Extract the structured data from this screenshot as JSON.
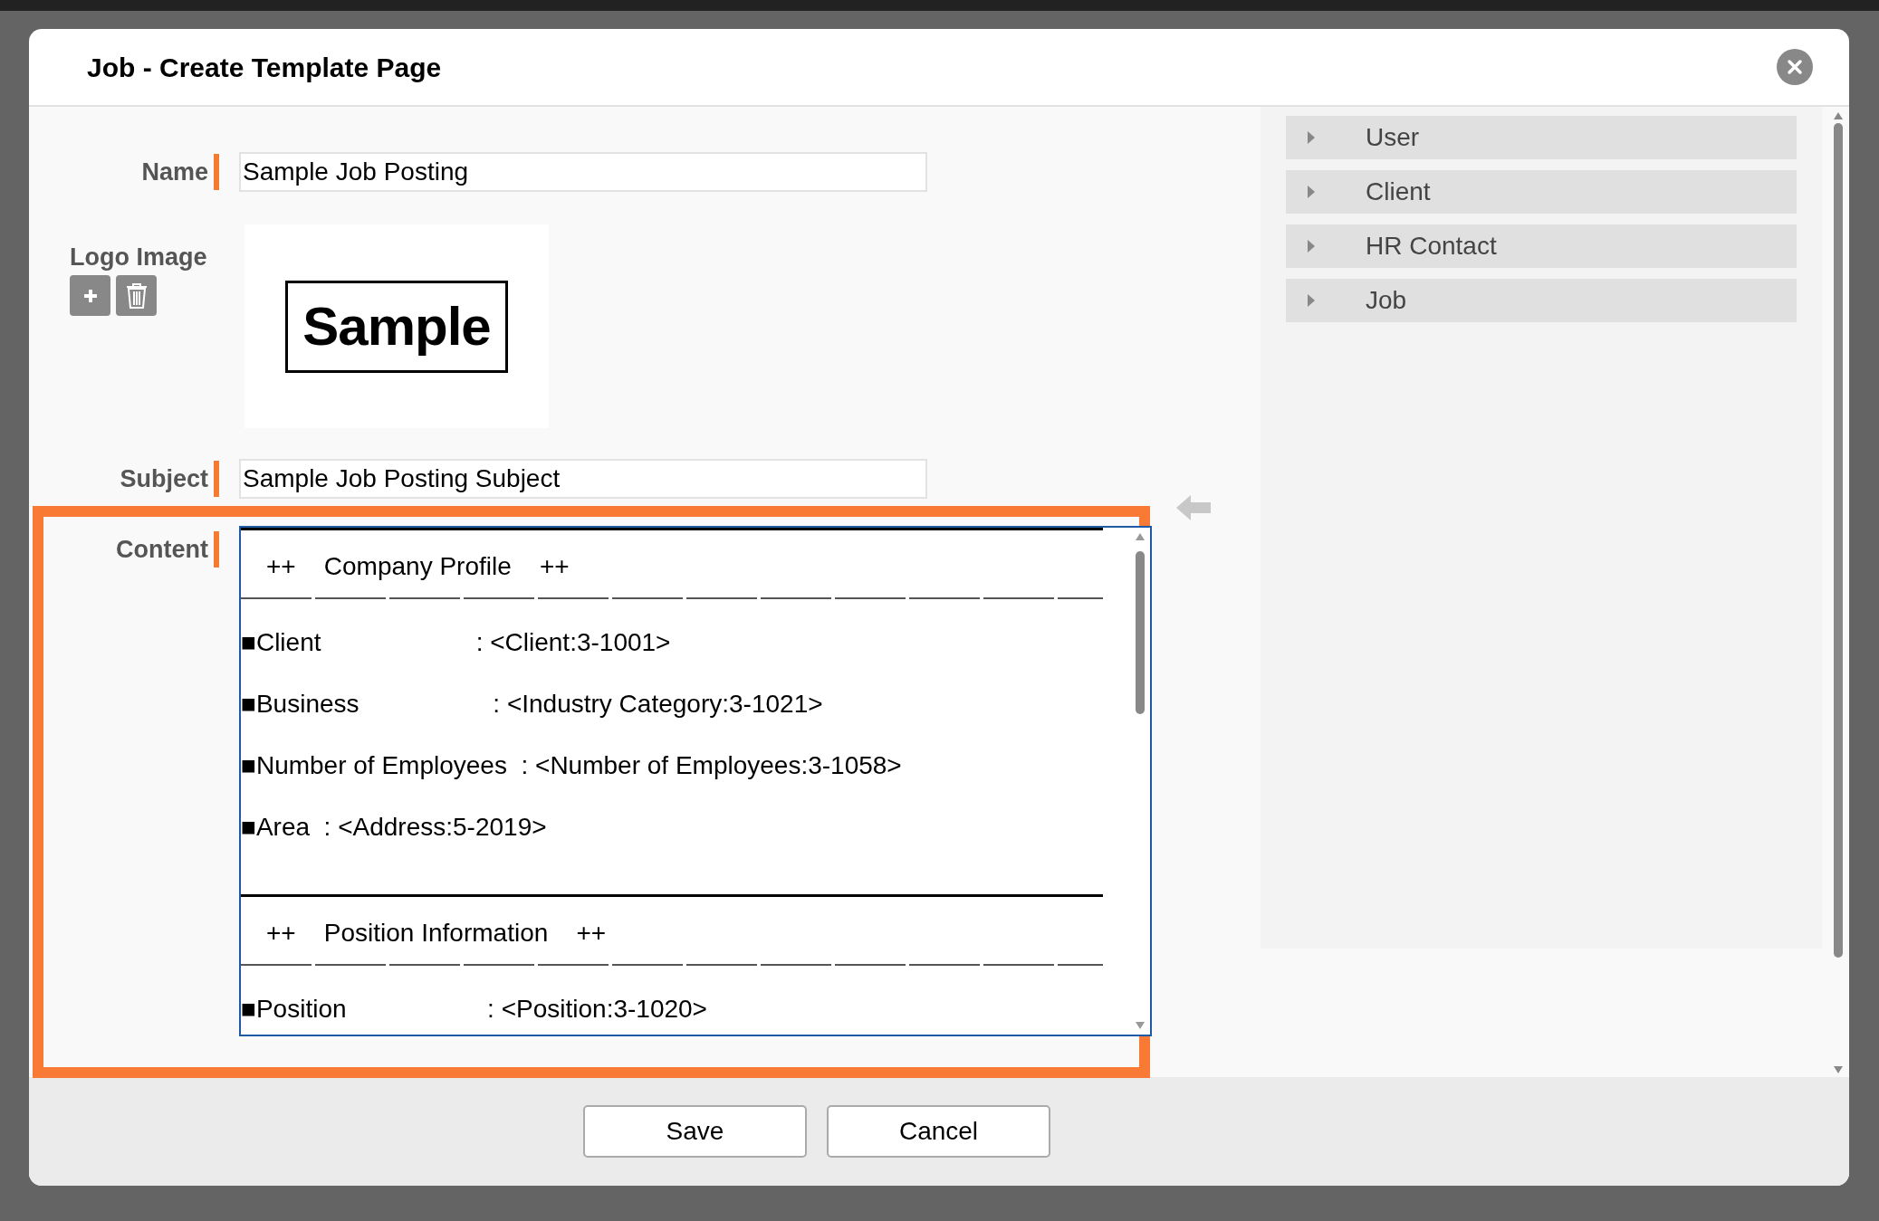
{
  "dialog": {
    "title": "Job - Create Template Page"
  },
  "form": {
    "name": {
      "label": "Name",
      "value": "Sample Job Posting",
      "required": true
    },
    "logo": {
      "label": "Logo Image",
      "image_text": "Sample"
    },
    "subject": {
      "label": "Subject",
      "value": "Sample Job Posting Subject",
      "required": true
    },
    "content": {
      "label": "Content",
      "required": true,
      "highlighted": true,
      "blocks": [
        {
          "kind": "rule"
        },
        {
          "kind": "heading",
          "prefix": "++",
          "text": "Company Profile",
          "suffix": "++"
        },
        {
          "kind": "dashes"
        },
        {
          "kind": "field",
          "bullet": "■",
          "text": "Client                      : <Client:3-1001>"
        },
        {
          "kind": "field",
          "bullet": "■",
          "text": "Business                   : <Industry Category:3-1021>"
        },
        {
          "kind": "field",
          "bullet": "■",
          "text": "Number of Employees  : <Number of Employees:3-1058>"
        },
        {
          "kind": "field",
          "bullet": "■",
          "text": "Area  : <Address:5-2019>"
        },
        {
          "kind": "rule"
        },
        {
          "kind": "heading",
          "prefix": "++",
          "text": "Position Information",
          "suffix": "++"
        },
        {
          "kind": "dashes"
        },
        {
          "kind": "field",
          "bullet": "■",
          "text": "Position                    : <Position:3-1020>"
        }
      ]
    }
  },
  "variables": [
    {
      "label": "User",
      "expanded": false
    },
    {
      "label": "Client",
      "expanded": false
    },
    {
      "label": "HR Contact",
      "expanded": false
    },
    {
      "label": "Job",
      "expanded": false
    }
  ],
  "buttons": [
    {
      "label": "Save"
    },
    {
      "label": "Cancel"
    }
  ]
}
